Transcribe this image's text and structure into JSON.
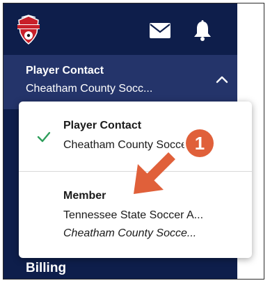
{
  "header": {
    "logo_icon": "club-crest-icon",
    "mail_icon": "mail-icon",
    "bell_icon": "bell-icon"
  },
  "context_selector": {
    "role": "Player Contact",
    "organization": "Cheatham County Socc...",
    "toggle_icon": "chevron-up-icon"
  },
  "dropdown": {
    "options": [
      {
        "selected": true,
        "check_icon": "check-icon",
        "role": "Player Contact",
        "organization": "Cheatham County Soccer..."
      },
      {
        "selected": false,
        "role": "Member",
        "organization": "Tennessee State Soccer A...",
        "sub_organization": "Cheatham County Socce..."
      }
    ]
  },
  "sidebar": {
    "billing_label": "Billing"
  },
  "annotation": {
    "step_number": "1",
    "color": "#e0603a"
  },
  "colors": {
    "sidebar_bg": "#0e1e4b",
    "context_bg": "#24346a",
    "check": "#2e9e5b"
  }
}
